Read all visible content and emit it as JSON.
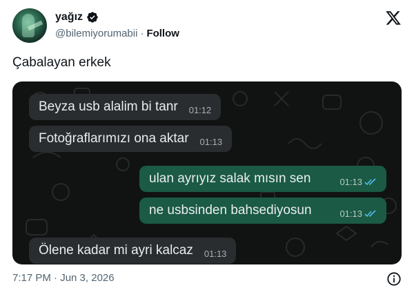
{
  "author": {
    "display_name": "yağız",
    "handle": "@bilemiyorumabii",
    "separator": "·",
    "follow_label": "Follow"
  },
  "tweet": {
    "text": "Çabalayan erkek",
    "timestamp": "7:17 PM · Jun 3, 2026"
  },
  "chat": {
    "messages": [
      {
        "direction": "in",
        "text": "Beyza usb alalim bi tanr",
        "time": "01:12"
      },
      {
        "direction": "in",
        "text": "Fotoğraflarımızı ona aktar",
        "time": "01:13"
      },
      {
        "direction": "out",
        "text": "ulan ayrıyız salak mısın sen",
        "time": "01:13",
        "read": true
      },
      {
        "direction": "out",
        "text": "ne usbsinden bahsediyosun",
        "time": "01:13",
        "read": true
      },
      {
        "direction": "in",
        "text": "Ölene kadar mi ayri kalcaz",
        "time": "01:13"
      }
    ]
  },
  "colors": {
    "verified_badge": "#0f1419",
    "incoming_bubble": "#2a2d2f",
    "outgoing_bubble": "#1b5a45",
    "read_ticks": "#53bdeb",
    "chat_background": "#111312"
  },
  "icons": {
    "verified": "verified-badge-icon",
    "brand": "x-logo-icon",
    "info": "info-icon",
    "read": "double-check-icon"
  }
}
